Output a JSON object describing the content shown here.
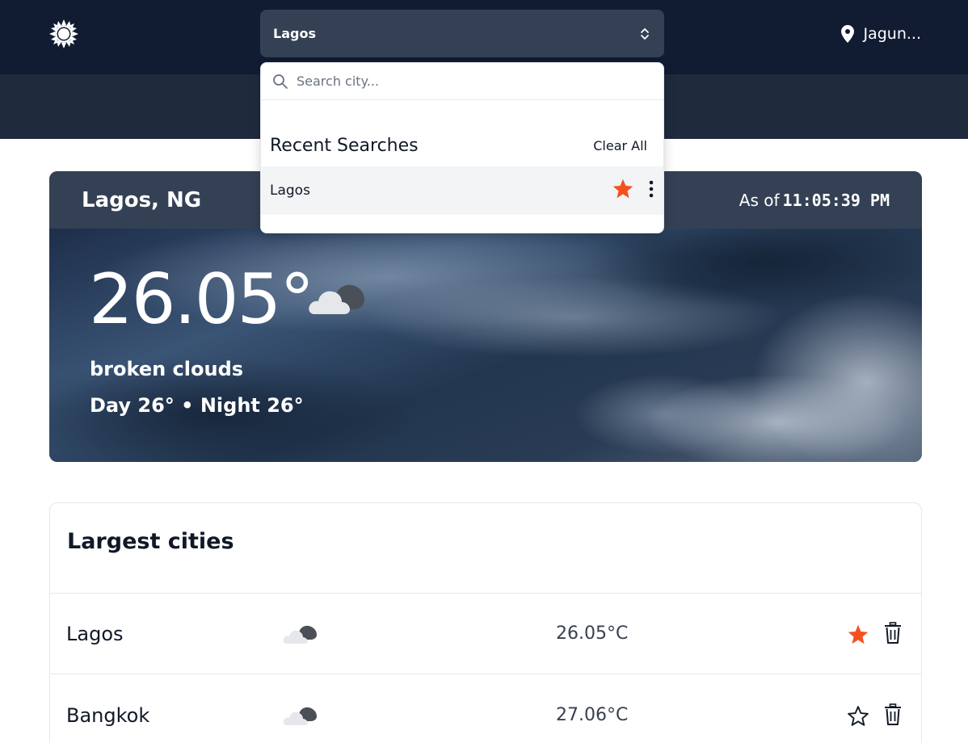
{
  "header": {
    "selected_city": "Lagos",
    "location_label": "Jagun..."
  },
  "search": {
    "placeholder": "Search city...",
    "recent_title": "Recent Searches",
    "clear_all_label": "Clear All",
    "recent_items": [
      {
        "label": "Lagos",
        "favorite": true
      }
    ]
  },
  "current": {
    "place": "Lagos, NG",
    "as_of_prefix": "As of",
    "time": "11:05:39 PM",
    "temperature": "26.05°",
    "description": "broken clouds",
    "day_night": "Day 26° • Night 26°",
    "icon": "broken-clouds-icon"
  },
  "cities": {
    "title": "Largest cities",
    "rows": [
      {
        "name": "Lagos",
        "temp": "26.05°C",
        "icon": "broken-clouds-icon",
        "favorite": true
      },
      {
        "name": "Bangkok",
        "temp": "27.06°C",
        "icon": "broken-clouds-icon",
        "favorite": false
      }
    ]
  },
  "colors": {
    "topbar": "#111c33",
    "subbar": "#1f2a3d",
    "select_bg": "#344154",
    "star_active": "#f4511e"
  }
}
